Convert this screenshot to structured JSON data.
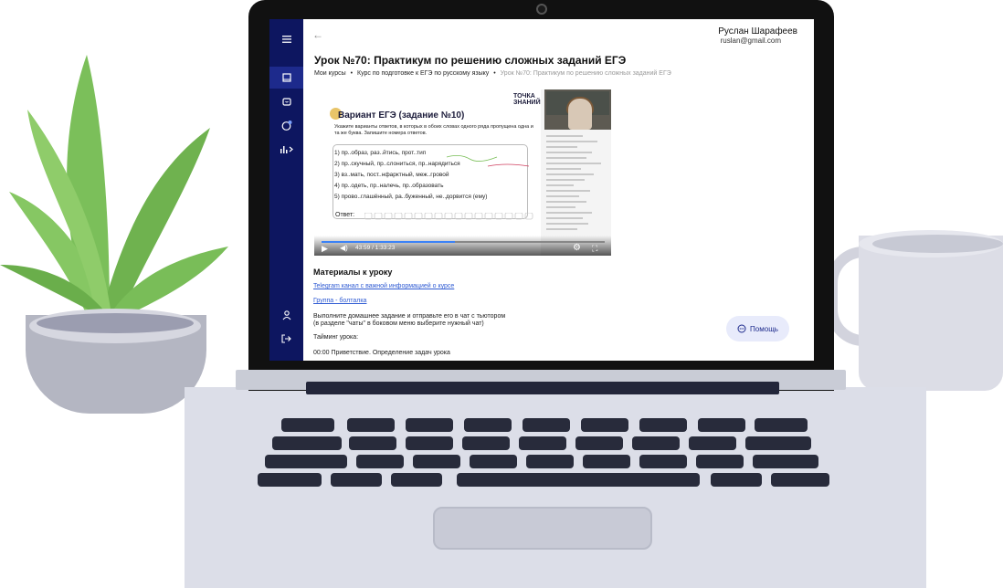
{
  "user": {
    "name": "Руслан Шарафеев",
    "email": "ruslan@gmail.com"
  },
  "lesson": {
    "title": "Урок №70: Практикум по решению сложных заданий ЕГЭ",
    "breadcrumbs": [
      "Мои курсы",
      "Курс по подготовке к ЕГЭ по русскому языку",
      "Урок №70: Практикум по решению сложных заданий ЕГЭ"
    ],
    "separator": "•"
  },
  "video": {
    "slide_title": "Вариант ЕГЭ (задание №10)",
    "slide_question": "Укажите варианты ответов, в которых в обоих словах одного ряда пропущена одна и та же буква. Запишите номера ответов.",
    "options": [
      "1)   пр..образ, раз..йтись, прот..тип",
      "2)   пр..скучный, пр..слониться, пр..нарядиться",
      "3)   вз..мать, пост..нфарктный, меж..гровой",
      "4)   пр..одеть, пр..налечь, пр..образовать",
      "5)   прово..глашённый, ра..буженный, не..дорвится (ему)"
    ],
    "answer_label": "Ответ:",
    "logo": "ТОЧКА ЗНАНИЙ",
    "time": "43:59 / 1:33:23",
    "progress": 0.47
  },
  "materials": {
    "heading": "Материалы к уроку",
    "links": [
      "Telegram канал с важной информацией о курсе",
      "Группа - болталка"
    ],
    "homework_line1": "Выполните домашнее задание и отправьте его в чат с тьютором",
    "homework_line2": "(в разделе \"чаты\" в боковом меню выберите нужный чат)",
    "timing_label": "Тайминг урока:",
    "timing_first": "00:00 Приветствие. Определение задач урока"
  },
  "help_label": "Помощь",
  "icons": {
    "menu": "menu-icon",
    "book": "book-icon",
    "bag": "bag-icon",
    "chat": "chat-icon",
    "stats": "stats-icon",
    "user": "user-icon",
    "logout": "logout-icon",
    "back": "back-arrow-icon"
  },
  "colors": {
    "sidebar": "#0d1660",
    "link": "#2f5bd3",
    "accent": "#1d2a8c"
  }
}
